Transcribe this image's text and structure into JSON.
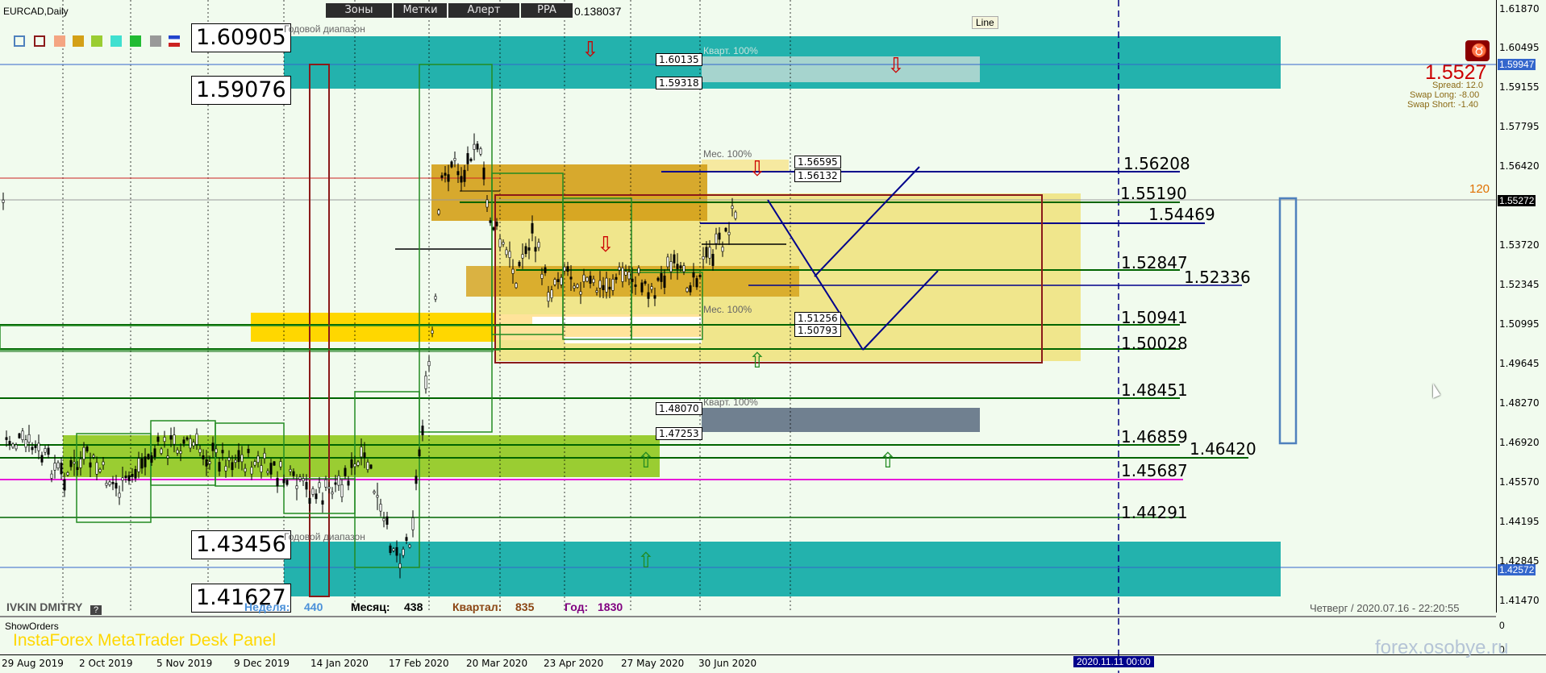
{
  "symbol": "EURCAD,Daily",
  "menu_tabs": [
    "Зоны",
    "Метки",
    "Алерт",
    "PPA"
  ],
  "ppa_value": "0.138037",
  "line_button": "Line",
  "year_range_label_top": "Годовой диапазон",
  "year_range_label_bottom": "Годовой диапазон",
  "big_levels": {
    "top1": "1.60905",
    "top2": "1.59076",
    "bot1": "1.43456",
    "bot2": "1.41627"
  },
  "small_levels": [
    "1.60135",
    "1.59318",
    "1.56595",
    "1.56132",
    "1.51256",
    "1.50793",
    "1.48070",
    "1.47253"
  ],
  "zone_labels": {
    "quarter_top": "Кварт. 100%",
    "month_top": "Мес. 100%",
    "month_bottom": "Мес. 100%",
    "quarter_bottom": "Кварт. 100%"
  },
  "right_levels": [
    "1.56208",
    "1.55190",
    "1.54469",
    "1.52847",
    "1.52336",
    "1.50941",
    "1.50028",
    "1.48451",
    "1.46859",
    "1.46420",
    "1.45687",
    "1.44291"
  ],
  "price_panel": {
    "price": "1.5527",
    "spread": "Spread: 12.0",
    "swap_long": "Swap Long: -8.00",
    "swap_short": "Swap Short: -1.40",
    "count": "120"
  },
  "price_axis": {
    "ticks": [
      "1.61870",
      "1.60495",
      "1.59155",
      "1.57795",
      "1.56420",
      "1.55060",
      "1.53720",
      "1.52345",
      "1.50995",
      "1.49645",
      "1.48270",
      "1.46920",
      "1.45570",
      "1.44195",
      "1.42845",
      "1.41470"
    ],
    "current_a": "1.59947",
    "current_b": "1.55272",
    "current_c": "1.42572"
  },
  "time_axis": [
    "29 Aug 2019",
    "2 Oct 2019",
    "5 Nov 2019",
    "9 Dec 2019",
    "14 Jan 2020",
    "17 Feb 2020",
    "20 Mar 2020",
    "23 Apr 2020",
    "27 May 2020",
    "30 Jun 2020"
  ],
  "time_cursor": "2020.11.11 00:00",
  "author": "IVKIN DMITRY",
  "help_button": "?",
  "stats": {
    "week_label": "Неделя:",
    "week": "440",
    "month_label": "Месяц:",
    "month": "438",
    "quarter_label": "Квартал:",
    "quarter": "835",
    "year_label": "Год:",
    "year": "1830"
  },
  "datetime": "Четверг  /  2020.07.16  -  22:20:55",
  "subwindow_label": "ShowOrders",
  "subwindow_scale_top": "0",
  "subwindow_scale_bottom": "0",
  "desk_panel": "InstaForex MetaTrader Desk Panel",
  "watermark": "forex.osobye.ru",
  "colors": {
    "teal": "#23b2ad",
    "green_zone": "#9acd32",
    "yellow_zone": "#ffd700",
    "light_yellow": "#f0e68c",
    "orange_zone": "#d4a017",
    "dark_red": "#8b1a1a",
    "navy": "#00008b",
    "blue_rect": "#4f81bd",
    "magenta": "#e81ad9"
  }
}
